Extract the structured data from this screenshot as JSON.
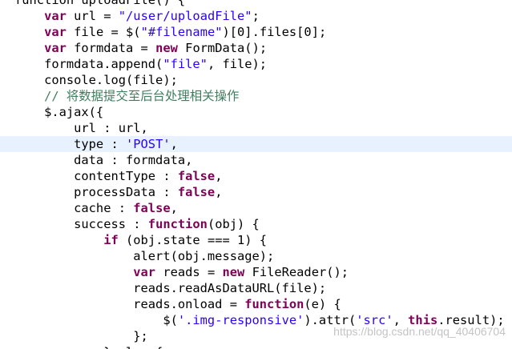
{
  "editor": {
    "language": "javascript",
    "highlighted_line": 9,
    "colors": {
      "background": "#ffffff",
      "current_line": "#e8f2fe",
      "keyword": "#7f0055",
      "string": "#2a00ff",
      "comment": "#3f7f5f",
      "default_text": "#000000",
      "watermark": "#c4c4c4"
    },
    "lines": [
      [
        {
          "t": "plain",
          "v": "function"
        },
        {
          "t": "plain",
          "v": " uploadFile() {"
        }
      ],
      [
        {
          "t": "plain",
          "v": "    "
        },
        {
          "t": "kw",
          "v": "var"
        },
        {
          "t": "plain",
          "v": " url = "
        },
        {
          "t": "str",
          "v": "\"/user/uploadFile\""
        },
        {
          "t": "plain",
          "v": ";"
        }
      ],
      [
        {
          "t": "plain",
          "v": "    "
        },
        {
          "t": "kw",
          "v": "var"
        },
        {
          "t": "plain",
          "v": " file = $("
        },
        {
          "t": "str",
          "v": "\"#filename\""
        },
        {
          "t": "plain",
          "v": ")[0].files[0];"
        }
      ],
      [
        {
          "t": "plain",
          "v": "    "
        },
        {
          "t": "kw",
          "v": "var"
        },
        {
          "t": "plain",
          "v": " formdata = "
        },
        {
          "t": "kw",
          "v": "new"
        },
        {
          "t": "plain",
          "v": " FormData();"
        }
      ],
      [
        {
          "t": "plain",
          "v": "    formdata.append("
        },
        {
          "t": "str",
          "v": "\"file\""
        },
        {
          "t": "plain",
          "v": ", file);"
        }
      ],
      [
        {
          "t": "plain",
          "v": "    console.log(file);"
        }
      ],
      [
        {
          "t": "plain",
          "v": "    "
        },
        {
          "t": "cmt",
          "v": "// 将数据提交至后台处理相关操作"
        }
      ],
      [
        {
          "t": "plain",
          "v": "    $.ajax({"
        }
      ],
      [
        {
          "t": "plain",
          "v": "        url : url,"
        }
      ],
      [
        {
          "t": "plain",
          "v": "        type : "
        },
        {
          "t": "str",
          "v": "'POST'"
        },
        {
          "t": "plain",
          "v": ","
        }
      ],
      [
        {
          "t": "plain",
          "v": "        data : formdata,"
        }
      ],
      [
        {
          "t": "plain",
          "v": "        contentType : "
        },
        {
          "t": "kw",
          "v": "false"
        },
        {
          "t": "plain",
          "v": ","
        }
      ],
      [
        {
          "t": "plain",
          "v": "        processData : "
        },
        {
          "t": "kw",
          "v": "false"
        },
        {
          "t": "plain",
          "v": ","
        }
      ],
      [
        {
          "t": "plain",
          "v": "        cache : "
        },
        {
          "t": "kw",
          "v": "false"
        },
        {
          "t": "plain",
          "v": ","
        }
      ],
      [
        {
          "t": "plain",
          "v": "        success : "
        },
        {
          "t": "kw",
          "v": "function"
        },
        {
          "t": "plain",
          "v": "(obj) {"
        }
      ],
      [
        {
          "t": "plain",
          "v": "            "
        },
        {
          "t": "kw",
          "v": "if"
        },
        {
          "t": "plain",
          "v": " (obj.state === 1) {"
        }
      ],
      [
        {
          "t": "plain",
          "v": "                alert(obj.message);"
        }
      ],
      [
        {
          "t": "plain",
          "v": "                "
        },
        {
          "t": "kw",
          "v": "var"
        },
        {
          "t": "plain",
          "v": " reads = "
        },
        {
          "t": "kw",
          "v": "new"
        },
        {
          "t": "plain",
          "v": " FileReader();"
        }
      ],
      [
        {
          "t": "plain",
          "v": "                reads.readAsDataURL(file);"
        }
      ],
      [
        {
          "t": "plain",
          "v": "                reads.onload = "
        },
        {
          "t": "kw",
          "v": "function"
        },
        {
          "t": "plain",
          "v": "(e) {"
        }
      ],
      [
        {
          "t": "plain",
          "v": "                    $("
        },
        {
          "t": "str",
          "v": "'.img-responsive'"
        },
        {
          "t": "plain",
          "v": ").attr("
        },
        {
          "t": "str",
          "v": "'src'"
        },
        {
          "t": "plain",
          "v": ", "
        },
        {
          "t": "kw",
          "v": "this"
        },
        {
          "t": "plain",
          "v": ".result);"
        }
      ],
      [
        {
          "t": "plain",
          "v": "                };"
        }
      ],
      [
        {
          "t": "plain",
          "v": "            } else {"
        }
      ]
    ]
  },
  "watermark": {
    "text": "https://blog.csdn.net/qq_40406704"
  }
}
